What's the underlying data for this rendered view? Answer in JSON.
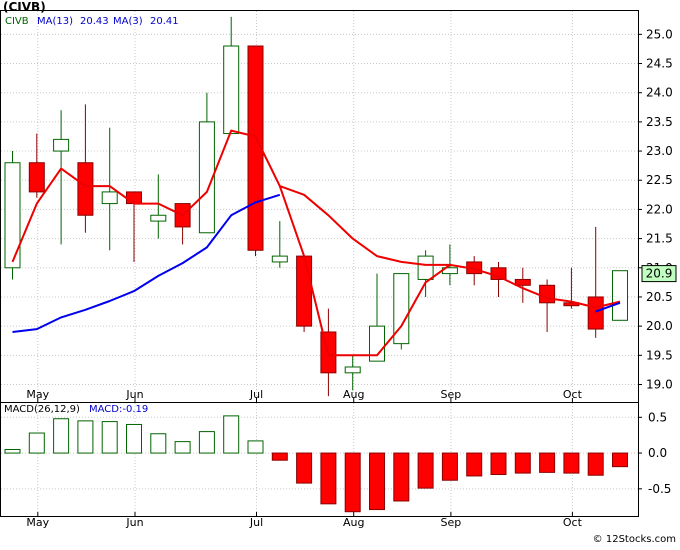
{
  "title": "(CIVB)",
  "watermark": "© 12Stocks.com",
  "colors": {
    "up_fill": "#ffffff",
    "up_stroke": "#006400",
    "down_fill": "#ff0000",
    "down_stroke": "#8b0000",
    "ma13": "#0000ee",
    "ma3": "#ee0000",
    "macd_pos_stroke": "#006400",
    "macd_neg_fill": "#ff0000",
    "grid": "#c8c8c8",
    "label_box": "#c0ffc0"
  },
  "chart_data": [
    {
      "type": "candlestick",
      "legend": {
        "symbol": "CIVB",
        "ma13_label": "MA(13)",
        "ma13_value": "20.43",
        "ma3_label": "MA(3)",
        "ma3_value": "20.41"
      },
      "ylim": [
        18.7,
        25.4
      ],
      "ytick_values": [
        19.0,
        19.5,
        20.0,
        20.5,
        21.0,
        21.5,
        22.0,
        22.5,
        23.0,
        23.5,
        24.0,
        24.5,
        25.0
      ],
      "ytick_labels": [
        "19.0",
        "19.5",
        "20.0",
        "20.5",
        "21.0",
        "21.5",
        "22.0",
        "22.5",
        "23.0",
        "23.5",
        "24.0",
        "24.5",
        "25.0"
      ],
      "last_price_label": "20.9",
      "last_price": 20.9,
      "x_labels": [
        "May",
        "Jun",
        "Jul",
        "Aug",
        "Sep",
        "Oct"
      ],
      "x_label_index": [
        1,
        5,
        10,
        14,
        18,
        23
      ],
      "candles": [
        {
          "o": 21.0,
          "h": 23.0,
          "l": 20.8,
          "c": 22.8
        },
        {
          "o": 22.8,
          "h": 23.3,
          "l": 22.2,
          "c": 22.3
        },
        {
          "o": 23.0,
          "h": 23.7,
          "l": 21.4,
          "c": 23.2
        },
        {
          "o": 22.8,
          "h": 23.8,
          "l": 21.6,
          "c": 21.9
        },
        {
          "o": 22.1,
          "h": 23.4,
          "l": 21.3,
          "c": 22.3
        },
        {
          "o": 22.3,
          "h": 22.3,
          "l": 21.1,
          "c": 22.1
        },
        {
          "o": 21.8,
          "h": 22.6,
          "l": 21.5,
          "c": 21.9
        },
        {
          "o": 22.1,
          "h": 22.1,
          "l": 21.4,
          "c": 21.7
        },
        {
          "o": 21.6,
          "h": 24.0,
          "l": 21.6,
          "c": 23.5
        },
        {
          "o": 23.3,
          "h": 25.3,
          "l": 23.3,
          "c": 24.8
        },
        {
          "o": 24.8,
          "h": 24.8,
          "l": 21.2,
          "c": 21.3
        },
        {
          "o": 21.1,
          "h": 21.8,
          "l": 21.0,
          "c": 21.2
        },
        {
          "o": 21.2,
          "h": 21.2,
          "l": 19.9,
          "c": 20.0
        },
        {
          "o": 19.9,
          "h": 20.3,
          "l": 18.8,
          "c": 19.2
        },
        {
          "o": 19.2,
          "h": 19.5,
          "l": 18.9,
          "c": 19.3
        },
        {
          "o": 19.4,
          "h": 20.9,
          "l": 19.4,
          "c": 20.0
        },
        {
          "o": 19.7,
          "h": 20.9,
          "l": 19.6,
          "c": 20.9
        },
        {
          "o": 20.8,
          "h": 21.3,
          "l": 20.5,
          "c": 21.2
        },
        {
          "o": 20.9,
          "h": 21.4,
          "l": 20.7,
          "c": 21.0
        },
        {
          "o": 21.1,
          "h": 21.2,
          "l": 20.7,
          "c": 20.9
        },
        {
          "o": 21.0,
          "h": 21.1,
          "l": 20.5,
          "c": 20.8
        },
        {
          "o": 20.8,
          "h": 21.0,
          "l": 20.4,
          "c": 20.7
        },
        {
          "o": 20.7,
          "h": 20.8,
          "l": 19.9,
          "c": 20.4
        },
        {
          "o": 20.4,
          "h": 21.0,
          "l": 20.3,
          "c": 20.35
        },
        {
          "o": 20.5,
          "h": 21.7,
          "l": 19.8,
          "c": 19.95
        },
        {
          "o": 20.1,
          "h": 20.95,
          "l": 20.1,
          "c": 20.95
        }
      ],
      "ma13": [
        {
          "i": 0,
          "v": 19.9
        },
        {
          "i": 1,
          "v": 19.95
        },
        {
          "i": 2,
          "v": 20.15
        },
        {
          "i": 3,
          "v": 20.28
        },
        {
          "i": 4,
          "v": 20.43
        },
        {
          "i": 5,
          "v": 20.6
        },
        {
          "i": 6,
          "v": 20.86
        },
        {
          "i": 7,
          "v": 21.08
        },
        {
          "i": 8,
          "v": 21.35
        },
        {
          "i": 9,
          "v": 21.9
        },
        {
          "i": 10,
          "v": 22.12
        },
        {
          "i": 11,
          "v": 22.25
        },
        {
          "i": 24,
          "v": 20.25
        },
        {
          "i": 25,
          "v": 20.4
        }
      ],
      "ma13_segments": [
        [
          0,
          11
        ],
        [
          24,
          25
        ]
      ],
      "ma3_main": [
        {
          "i": 0,
          "v": 21.1
        },
        {
          "i": 1,
          "v": 22.1
        },
        {
          "i": 2,
          "v": 22.7
        },
        {
          "i": 3,
          "v": 22.4
        },
        {
          "i": 4,
          "v": 22.4
        },
        {
          "i": 5,
          "v": 22.1
        },
        {
          "i": 6,
          "v": 22.1
        },
        {
          "i": 7,
          "v": 21.9
        },
        {
          "i": 8,
          "v": 22.3
        },
        {
          "i": 9,
          "v": 23.35
        },
        {
          "i": 10,
          "v": 23.25
        },
        {
          "i": 11,
          "v": 22.4
        },
        {
          "i": 12,
          "v": 22.25
        },
        {
          "i": 13,
          "v": 21.9
        },
        {
          "i": 14,
          "v": 21.5
        },
        {
          "i": 15,
          "v": 21.2
        },
        {
          "i": 16,
          "v": 21.1
        },
        {
          "i": 17,
          "v": 21.05
        },
        {
          "i": 18,
          "v": 21.05
        },
        {
          "i": 19,
          "v": 20.98
        },
        {
          "i": 20,
          "v": 20.85
        },
        {
          "i": 21,
          "v": 20.65
        },
        {
          "i": 22,
          "v": 20.48
        },
        {
          "i": 23,
          "v": 20.42
        },
        {
          "i": 24,
          "v": 20.32
        },
        {
          "i": 25,
          "v": 20.42
        }
      ],
      "ma3_dip": [
        {
          "i": 11,
          "v": 22.4
        },
        {
          "i": 12,
          "v": 21.2
        },
        {
          "i": 13,
          "v": 19.5
        },
        {
          "i": 14,
          "v": 19.5
        },
        {
          "i": 15,
          "v": 19.5
        },
        {
          "i": 16,
          "v": 20.0
        },
        {
          "i": 17,
          "v": 20.75
        },
        {
          "i": 18,
          "v": 21.05
        }
      ]
    },
    {
      "type": "bar",
      "legend": {
        "label": "MACD(26,12,9)",
        "value_label": "MACD:-0.19"
      },
      "ylim": [
        -0.88,
        0.7
      ],
      "ytick_values": [
        0.5,
        0.0,
        -0.5
      ],
      "ytick_labels": [
        "0.5",
        "0.0",
        "-0.5"
      ],
      "x_labels": [
        "May",
        "Jun",
        "Jul",
        "Aug",
        "Sep",
        "Oct"
      ],
      "x_label_index": [
        1,
        5,
        10,
        14,
        18,
        23
      ],
      "values": [
        0.05,
        0.28,
        0.48,
        0.45,
        0.44,
        0.4,
        0.27,
        0.16,
        0.3,
        0.52,
        0.17,
        -0.1,
        -0.42,
        -0.71,
        -0.82,
        -0.79,
        -0.67,
        -0.49,
        -0.38,
        -0.32,
        -0.3,
        -0.28,
        -0.27,
        -0.28,
        -0.31,
        -0.19
      ]
    }
  ]
}
